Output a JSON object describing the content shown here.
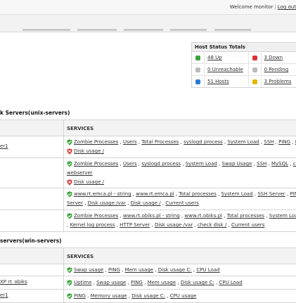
{
  "header": {
    "welcome": "Welcome monitor",
    "logout": "Log out"
  },
  "host_status": {
    "title": "Host Status Totals",
    "items": [
      {
        "label": "48 Up",
        "icon": "green-check-shield-icon",
        "color": "#3aa53a"
      },
      {
        "label": "3 Down",
        "icon": "red-shield-icon",
        "color": "#dd3333"
      },
      {
        "label": "0 Unreachable",
        "icon": "grey-shield-icon",
        "color": "#bbbbbb"
      },
      {
        "label": "0 Pending",
        "icon": "grey-shield-icon",
        "color": "#bbbbbb"
      },
      {
        "label": "51 Hosts",
        "icon": "blue-shield-icon",
        "color": "#2e7bd6"
      },
      {
        "label": "3 Problems",
        "icon": "warning-icon",
        "color": "#e6b800"
      }
    ]
  },
  "unix_group": {
    "title": "k Servers(unix-servers)",
    "services_header": "SERVICES",
    "rows": [
      {
        "host": "er1",
        "lines": [
          {
            "status": "ok",
            "services": [
              "Zombie Processes",
              "Users",
              "Total Processes",
              "syslogd process",
              "System Load",
              "SSH",
              "PING",
              "NTP",
              ""
            ]
          },
          {
            "status": "critical",
            "services": [
              "Disk usage /"
            ]
          }
        ]
      },
      {
        "host": "",
        "lines": [
          {
            "status": "ok",
            "services": [
              "Zombie Processes",
              "Users",
              "syslogd process",
              "System Load",
              "Swap Usage",
              "SSH",
              "MySQL",
              "cron p"
            ]
          },
          {
            "status": "none",
            "services": [
              "webserver"
            ]
          },
          {
            "status": "critical",
            "services": [
              "Disk usage /"
            ]
          }
        ]
      },
      {
        "host": "",
        "lines": [
          {
            "status": "ok",
            "services": [
              "www.rt.emca.pl - string",
              "www.rt.emca.pl",
              "Total processes",
              "System Load",
              "SSH Server",
              "PING",
              ""
            ]
          },
          {
            "status": "none",
            "services": [
              "Server",
              "Disk usage /var",
              "Disk usage /",
              "Current users"
            ]
          }
        ]
      },
      {
        "host": "",
        "lines": [
          {
            "status": "ok",
            "services": [
              "Zombie Processes",
              "www.rt.obiks.pl - string",
              "www.rt.obiks.pl",
              "Total processes",
              "System Load",
              "S"
            ]
          },
          {
            "status": "none",
            "services": [
              "Kernel log process",
              "HTTP Server",
              "Disk usage /var",
              "check disk /",
              "Current users"
            ],
            "leading_comma": true
          }
        ]
      }
    ]
  },
  "win_group": {
    "title": "servers(win-servers)",
    "services_header": "SERVICES",
    "rows": [
      {
        "host": "",
        "lines": [
          {
            "status": "ok",
            "services": [
              "Swap usage",
              "PING",
              "Mem usage",
              "Disk usage C:",
              "CPU Load"
            ]
          }
        ]
      },
      {
        "host": "XP rt_obiks",
        "lines": [
          {
            "status": "ok",
            "services": [
              "Uptime",
              "Swap usage",
              "PING",
              "Mem usage",
              "Disk usage C:",
              "CPU Load"
            ]
          }
        ]
      },
      {
        "host": "er1",
        "lines": [
          {
            "status": "ok",
            "services": [
              "PING",
              "Memory usage",
              "Disk usage C:",
              "CPU usage"
            ]
          }
        ]
      }
    ]
  }
}
